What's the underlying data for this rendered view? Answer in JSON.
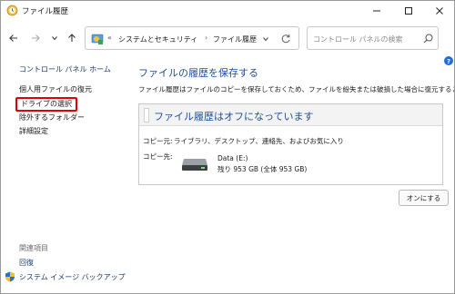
{
  "window": {
    "title": "ファイル履歴"
  },
  "address_bar": {
    "overflow": "«",
    "crumbs": [
      "システムとセキュリティ",
      "ファイル履歴"
    ],
    "separator": "›"
  },
  "search": {
    "placeholder": "コントロール パネルの検索"
  },
  "sidebar": {
    "home": "コントロール パネル ホーム",
    "items": [
      {
        "label": "個人用ファイルの復元"
      },
      {
        "label": "ドライブの選択",
        "highlighted": true
      },
      {
        "label": "除外するフォルダー"
      },
      {
        "label": "詳細設定"
      }
    ],
    "related_heading": "関連項目",
    "related": [
      {
        "label": "回復"
      },
      {
        "label": "システム イメージ バックアップ"
      }
    ]
  },
  "main": {
    "title": "ファイルの履歴を保存する",
    "description": "ファイル履歴はファイルのコピーを保存しておくため、ファイルを紛失または破損した場合に復元することができます",
    "status": {
      "title": "ファイル履歴はオフになっています",
      "copy_from_label": "コピー元:",
      "copy_from_value": "ライブラリ、デスクトップ、連絡先、およびお気に入り",
      "copy_to_label": "コピー先:",
      "drive_name": "Data (E:)",
      "drive_space": "残り 953 GB (全体 953 GB)"
    },
    "turn_on_button": "オンにする"
  },
  "colors": {
    "link_blue": "#1e4f96",
    "highlight_red": "#e00000"
  }
}
